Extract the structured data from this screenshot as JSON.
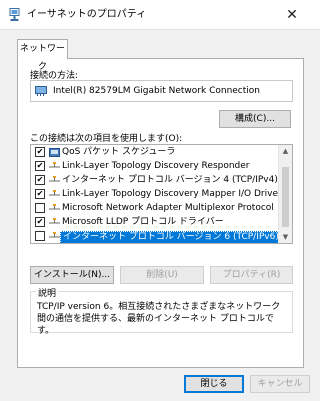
{
  "window": {
    "title": "イーサネットのプロパティ",
    "icon": "network-adapter-icon",
    "close_glyph": "✕"
  },
  "tabs": [
    {
      "label": "ネットワーク",
      "active": true
    }
  ],
  "connection": {
    "label": "接続の方法:",
    "adapter": "Intel(R) 82579LM Gigabit Network Connection",
    "configure_label": "構成(C)..."
  },
  "items": {
    "label": "この接続は次の項目を使用します(O):",
    "list": [
      {
        "text": "QoS パケット スケジューラ",
        "checked": true,
        "icon": "qos-scheduler-icon"
      },
      {
        "text": "Link-Layer Topology Discovery Responder",
        "checked": true,
        "icon": "protocol-icon"
      },
      {
        "text": "インターネット プロトコル バージョン 4 (TCP/IPv4)",
        "checked": true,
        "icon": "protocol-icon"
      },
      {
        "text": "Link-Layer Topology Discovery Mapper I/O Driver",
        "checked": true,
        "icon": "protocol-icon"
      },
      {
        "text": "Microsoft Network Adapter Multiplexor Protocol",
        "checked": false,
        "icon": "protocol-icon"
      },
      {
        "text": "Microsoft LLDP プロトコル ドライバー",
        "checked": true,
        "icon": "protocol-icon"
      },
      {
        "text": "インターネット プロトコル バージョン 6 (TCP/IPv6)",
        "checked": false,
        "icon": "protocol-icon",
        "selected": true
      }
    ]
  },
  "buttons": {
    "install": "インストール(N)...",
    "uninstall": "削除(U)",
    "properties": "プロパティ(R)"
  },
  "description": {
    "title": "説明",
    "text": "TCP/IP version 6。相互接続されたさまざまなネットワーク間の通信を提供する、最新のインターネット プロトコルです。"
  },
  "footer": {
    "close": "閉じる",
    "cancel": "キャンセル"
  },
  "colors": {
    "selection": "#0078d7",
    "checkmark": "#000000"
  }
}
